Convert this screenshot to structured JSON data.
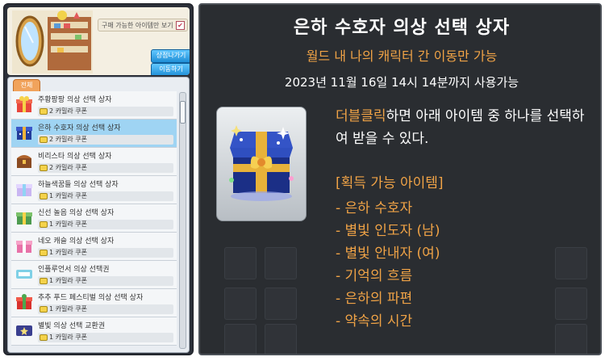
{
  "shop": {
    "show_toggle_label": "구매 가능한 아이템만 보기",
    "exit_button": "상점나가기",
    "move_button": "이동하기",
    "tab_all": "전체",
    "items": [
      {
        "name": "주황팡팡 의상 선택 상자",
        "price": "2 카밀라 쿠폰",
        "icon": "gift-box-icon"
      },
      {
        "name": "은하 수호자 의상 선택 상자",
        "price": "2 카밀라 쿠폰",
        "icon": "galaxy-box-icon"
      },
      {
        "name": "비리스타 의상 선택 상자",
        "price": "2 카밀라 쿠폰",
        "icon": "treasure-box-icon"
      },
      {
        "name": "하늘색꿈들 의상 선택 상자",
        "price": "1 카밀라 쿠폰",
        "icon": "pastel-box-icon"
      },
      {
        "name": "신선 놀음 의상 선택 상자",
        "price": "1 카밀라 쿠폰",
        "icon": "green-box-icon"
      },
      {
        "name": "네오 캐슬 의상 선택 상자",
        "price": "1 카밀라 쿠폰",
        "icon": "pink-box-icon"
      },
      {
        "name": "인플루언서 의상 선택권",
        "price": "1 카밀라 쿠폰",
        "icon": "ticket-icon"
      },
      {
        "name": "추추 푸드 페스티벌 의상 선택 상자",
        "price": "1 카밀라 쿠폰",
        "icon": "red-gift-box-icon"
      },
      {
        "name": "별빛 의상 선택 교환권",
        "price": "1 카밀라 쿠폰",
        "icon": "starlight-ticket-icon"
      }
    ]
  },
  "tooltip": {
    "title": "은하 수호자 의상 선택 상자",
    "subtitle": "월드 내 나의 캐릭터 간 이동만 가능",
    "expiry": "2023년 11월 16일 14시 14분까지 사용가능",
    "desc_highlight": "더블클릭",
    "desc_rest": "하면 아래 아이템 중 하나를 선택하여 받을 수 있다.",
    "gain_title": "[획득 가능 아이템]",
    "gain_items": [
      "- 은하 수호자",
      "- 별빛 인도자 (남)",
      "- 별빛 안내자 (여)",
      "- 기억의 흐름",
      "- 은하의 파편",
      "- 약속의 시간"
    ]
  },
  "colors": {
    "accent_orange": "#f0a346",
    "tooltip_bg": "#2a2d31",
    "selected_row": "#9fd4f3",
    "button_blue": "#1f8ed6"
  }
}
